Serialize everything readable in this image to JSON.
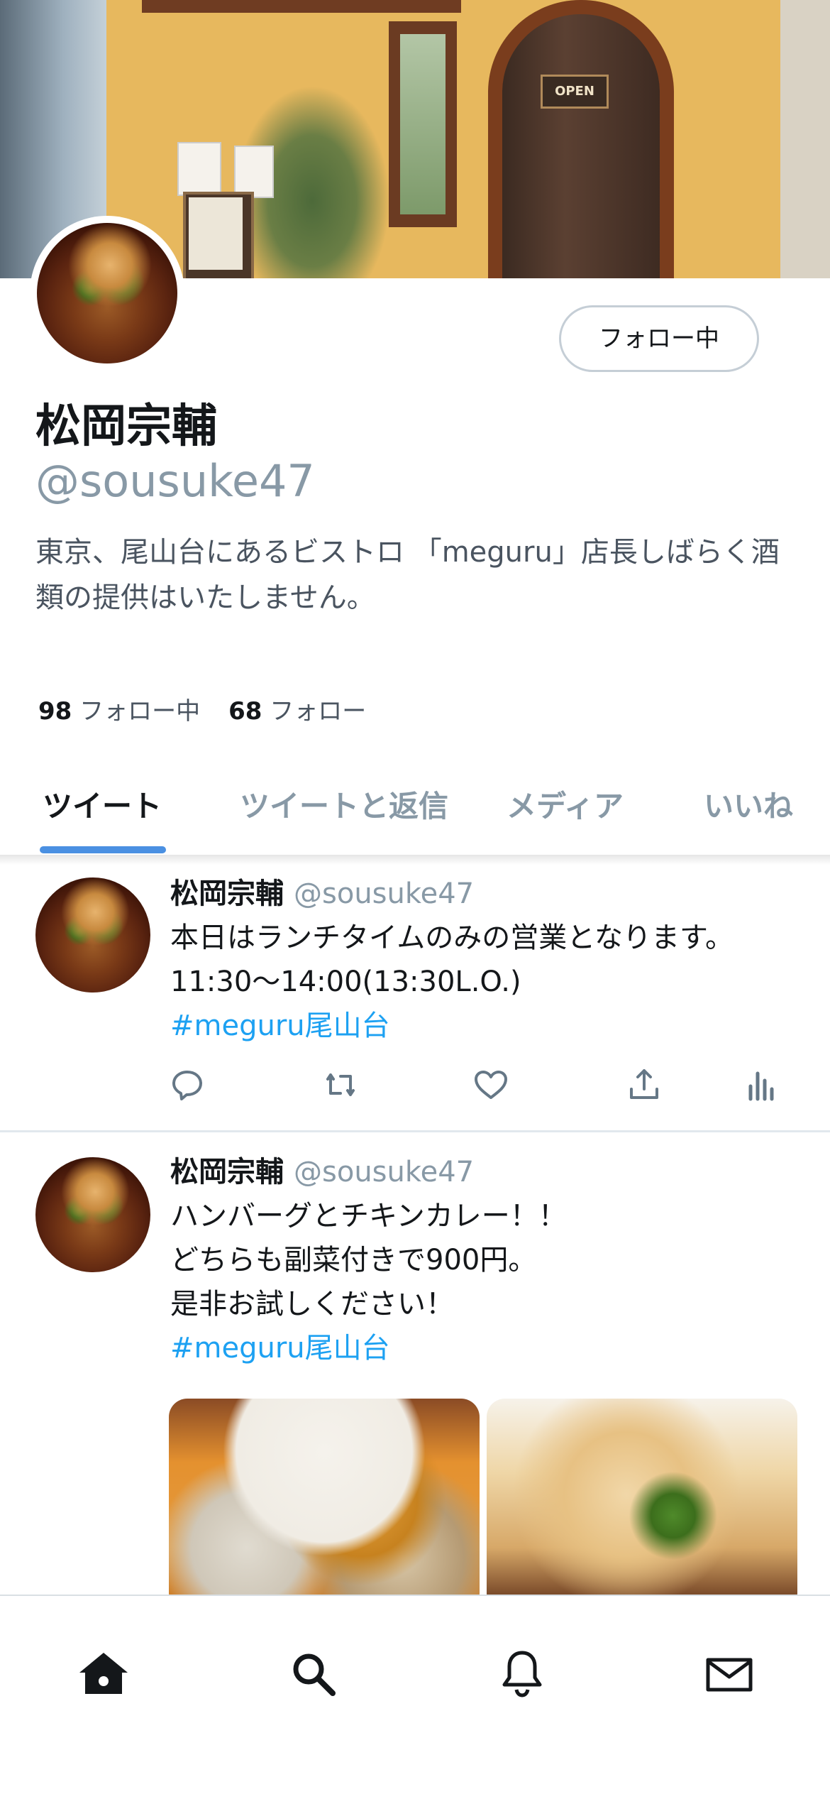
{
  "profile": {
    "display_name": "松岡宗輔",
    "handle": "@sousuke47",
    "bio": "東京、尾山台にあるビストロ 「meguru」店長しばらく酒類の提供はいたしません。",
    "follow_button_label": "フォロー中",
    "header_sign_text": "OPEN"
  },
  "stats": {
    "following_count": "98",
    "following_label": "フォロー中",
    "followers_count": "68",
    "followers_label": "フォロー"
  },
  "tabs": [
    {
      "label": "ツイート",
      "active": true
    },
    {
      "label": "ツイートと返信",
      "active": false
    },
    {
      "label": "メディア",
      "active": false
    },
    {
      "label": "いいね",
      "active": false
    }
  ],
  "tweets": [
    {
      "name": "松岡宗輔",
      "handle": "@sousuke47",
      "text": "本日はランチタイムのみの営業となります。\n11:30〜14:00(13:30L.O.)",
      "hashtag": "#meguru尾山台"
    },
    {
      "name": "松岡宗輔",
      "handle": "@sousuke47",
      "text": "ハンバーグとチキンカレー！！\nどちらも副菜付きで900円。\n是非お試しください！",
      "hashtag": "#meguru尾山台",
      "media": [
        "curry-photo",
        "pasta-photo"
      ]
    }
  ],
  "tweet_actions": [
    "reply-icon",
    "retweet-icon",
    "like-icon",
    "share-icon",
    "analytics-icon"
  ],
  "bottom_nav": [
    "home-icon",
    "search-icon",
    "notifications-icon",
    "messages-icon"
  ],
  "colors": {
    "link": "#1da1f2",
    "tab_indicator": "#4a90e2",
    "secondary_text": "#8899a6"
  }
}
